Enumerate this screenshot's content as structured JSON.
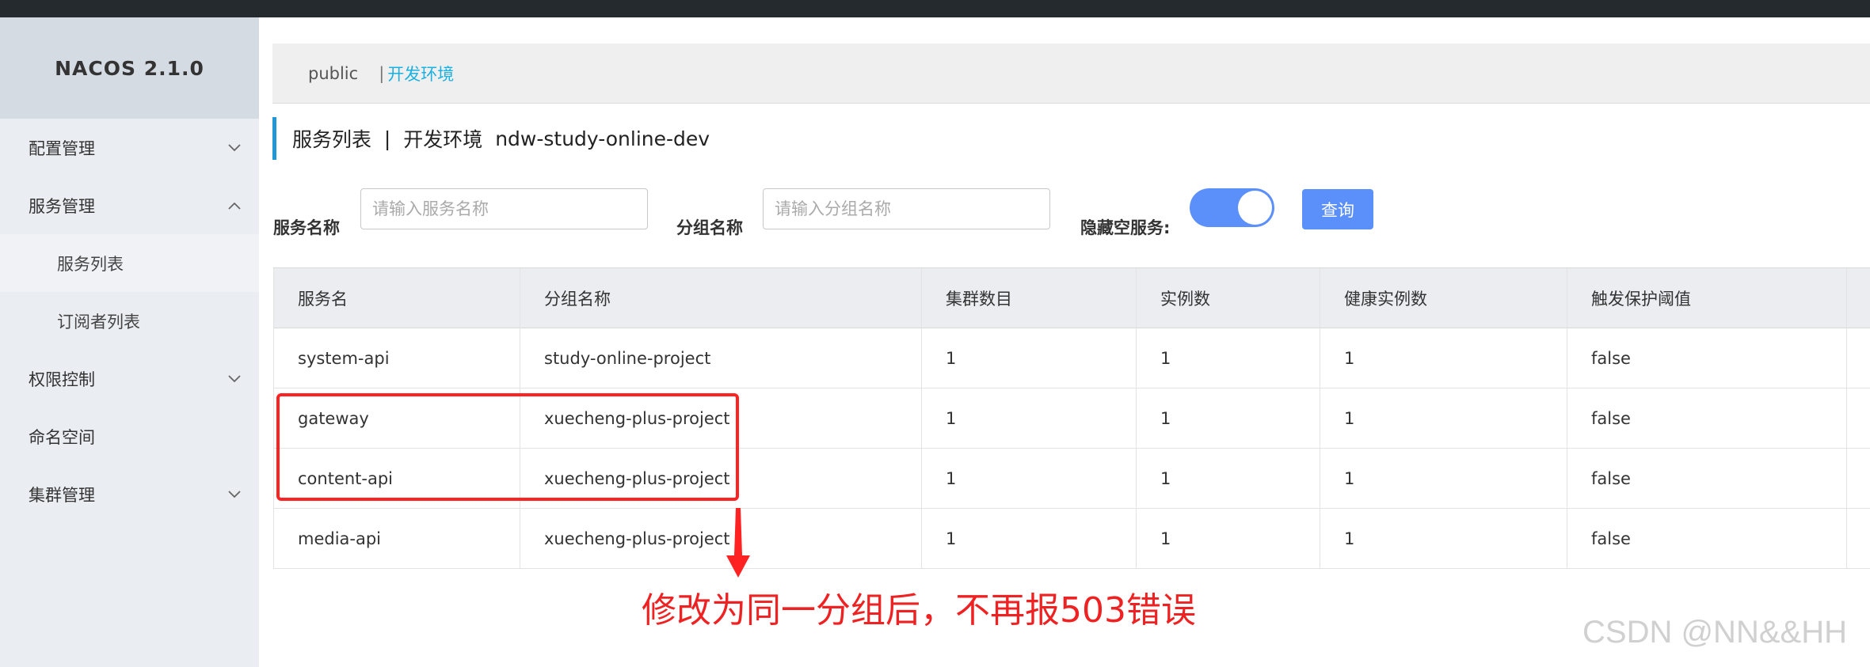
{
  "brand": "NACOS 2.1.0",
  "sidebar": {
    "items": [
      {
        "label": "配置管理",
        "expanded": false
      },
      {
        "label": "服务管理",
        "expanded": true
      },
      {
        "label": "服务列表",
        "sub": true,
        "active": true
      },
      {
        "label": "订阅者列表",
        "sub": true
      },
      {
        "label": "权限控制",
        "expanded": false
      },
      {
        "label": "命名空间"
      },
      {
        "label": "集群管理",
        "expanded": false
      }
    ]
  },
  "namespace_bar": {
    "public": "public",
    "separator": "|",
    "current": "开发环境"
  },
  "page_title": {
    "title": "服务列表",
    "separator": "|",
    "namespace": "开发环境",
    "namespace_id": "ndw-study-online-dev"
  },
  "filters": {
    "service_name_label": "服务名称",
    "service_name_placeholder": "请输入服务名称",
    "group_name_label": "分组名称",
    "group_name_placeholder": "请输入分组名称",
    "hide_empty_label": "隐藏空服务:",
    "hide_empty_on": true,
    "query_button": "查询"
  },
  "table": {
    "columns": [
      "服务名",
      "分组名称",
      "集群数目",
      "实例数",
      "健康实例数",
      "触发保护阈值"
    ],
    "rows": [
      [
        "system-api",
        "study-online-project",
        "1",
        "1",
        "1",
        "false"
      ],
      [
        "gateway",
        "xuecheng-plus-project",
        "1",
        "1",
        "1",
        "false"
      ],
      [
        "content-api",
        "xuecheng-plus-project",
        "1",
        "1",
        "1",
        "false"
      ],
      [
        "media-api",
        "xuecheng-plus-project",
        "1",
        "1",
        "1",
        "false"
      ]
    ]
  },
  "annotation": "修改为同一分组后，不再报503错误",
  "watermark": "CSDN @NN&&HH",
  "colors": {
    "accent": "#5b8ff9",
    "namespace_link": "#1ab0e0",
    "annotation_red": "#ee2222"
  }
}
